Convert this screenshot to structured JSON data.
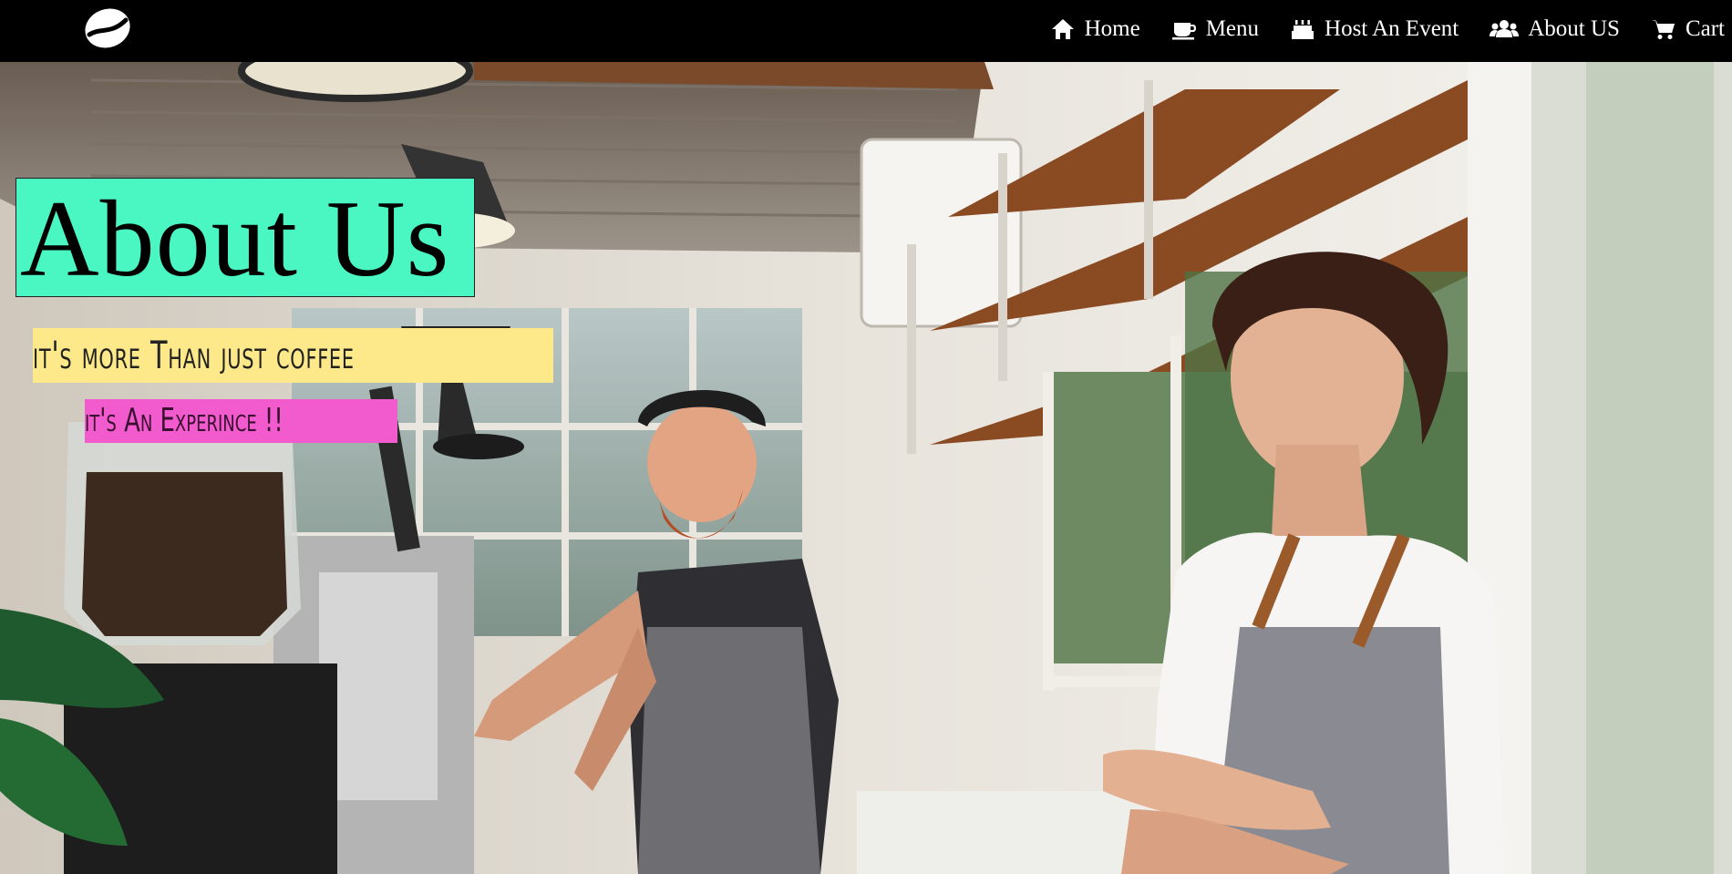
{
  "navbar": {
    "logo_icon": "coffee-bean-icon",
    "items": [
      {
        "label": "Home",
        "icon": "home-icon"
      },
      {
        "label": "Menu",
        "icon": "coffee-cup-icon"
      },
      {
        "label": "Host An Event",
        "icon": "birthday-cake-icon"
      },
      {
        "label": "About US",
        "icon": "users-icon"
      },
      {
        "label": "Cart",
        "icon": "shopping-cart-icon"
      }
    ]
  },
  "hero": {
    "title": "About Us",
    "tagline": "it's more Than just coffee",
    "subtitle": "it's An Experince !!",
    "image": "photo of two smiling baristas in a coffee shop"
  },
  "colors": {
    "navbar_bg": "#000000",
    "title_bg": "#4af7c2",
    "tagline_bg": "#fde98a",
    "subtitle_bg": "#f25bce"
  }
}
